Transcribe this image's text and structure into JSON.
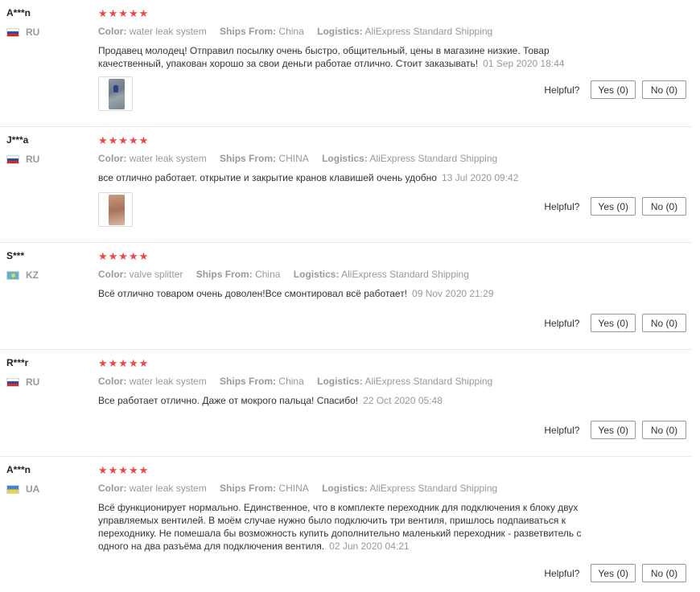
{
  "helpful_label": "Helpful?",
  "labels": {
    "color": "Color:",
    "ships_from": "Ships From:",
    "logistics": "Logistics:"
  },
  "stars": "★★★★★",
  "accent_star_color": "#f04646",
  "reviews": [
    {
      "user": "A***n",
      "country": "RU",
      "color": "water leak system",
      "ships_from": "China",
      "logistics": "AliExpress Standard Shipping",
      "text": "Продавец молодец! Отправил посылку очень быстро, общительный, цены в магазине низкие. Товар качественный, упакован хорошо за свои деньги работае отлично. Стоит заказывать!",
      "date": "01 Sep 2020 18:44",
      "yes": "Yes (0)",
      "no": "No (0)"
    },
    {
      "user": "J***a",
      "country": "RU",
      "color": "water leak system",
      "ships_from": "CHINA",
      "logistics": "AliExpress Standard Shipping",
      "text": "все отлично работает. открытие и закрытие кранов клавишей очень удобно",
      "date": "13 Jul 2020 09:42",
      "yes": "Yes (0)",
      "no": "No (0)"
    },
    {
      "user": "S***",
      "country": "KZ",
      "color": "valve splitter",
      "ships_from": "China",
      "logistics": "AliExpress Standard Shipping",
      "text": "Всё отлично товаром очень доволен!Все смонтировал всё работает!",
      "date": "09 Nov 2020 21:29",
      "yes": "Yes (0)",
      "no": "No (0)"
    },
    {
      "user": "R***r",
      "country": "RU",
      "color": "water leak system",
      "ships_from": "China",
      "logistics": "AliExpress Standard Shipping",
      "text": "Все работает отлично. Даже от мокрого пальца! Спасибо!",
      "date": "22 Oct 2020 05:48",
      "yes": "Yes (0)",
      "no": "No (0)"
    },
    {
      "user": "A***n",
      "country": "UA",
      "color": "water leak system",
      "ships_from": "CHINA",
      "logistics": "AliExpress Standard Shipping",
      "text": "Всё функционирует нормально. Единственное, что в комплекте переходник для подключения к блоку двух управляемых вентилей. В моём случае нужно было подключить три вентиля, пришлось подпаиваться к переходнику. Не помешала бы возможность купить дополнительно маленький переходник - разветвитель с одного на два разъёма для подключения вентиля.",
      "date": "02 Jun 2020 04:21",
      "yes": "Yes (0)",
      "no": "No (0)"
    }
  ]
}
